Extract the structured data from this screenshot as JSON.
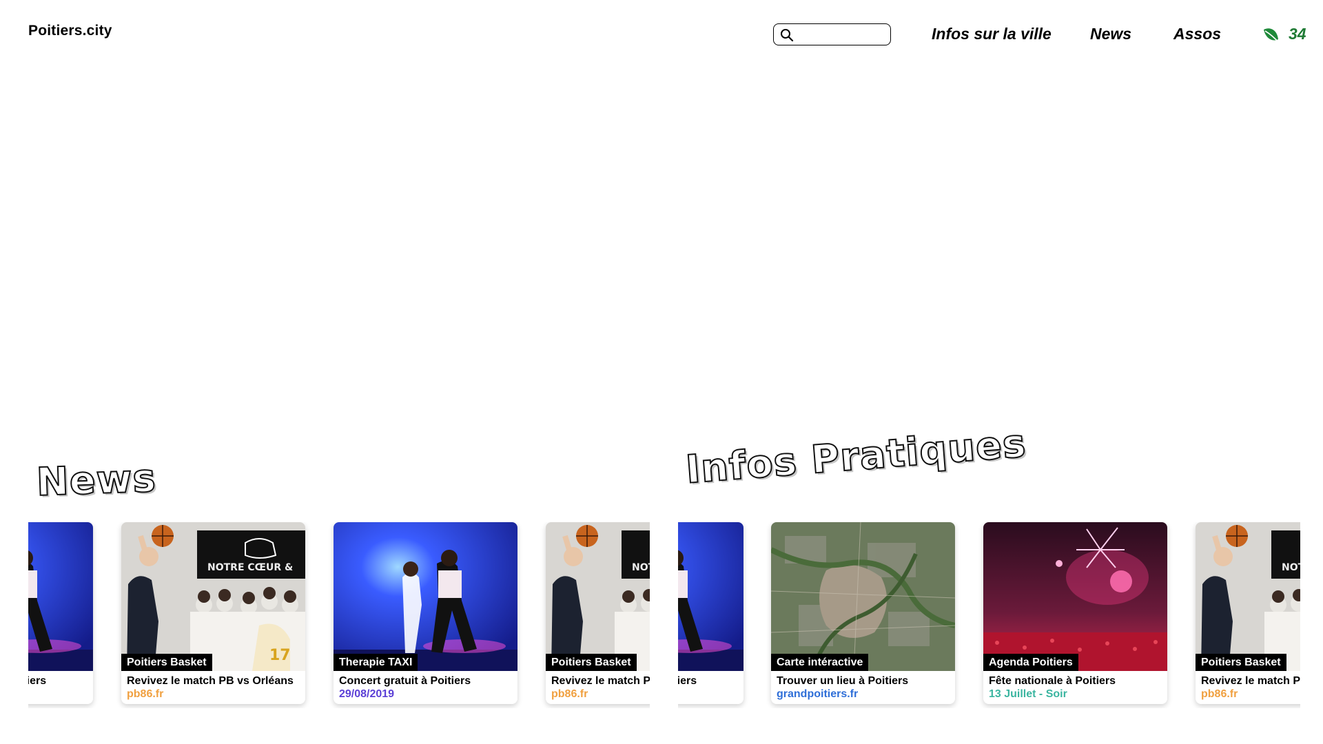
{
  "header": {
    "logo": "Poitiers.city",
    "search_placeholder": "",
    "nav": [
      "Infos sur la ville",
      "News",
      "Assos"
    ],
    "counter": "34"
  },
  "sections": {
    "news_title": "News",
    "infos_title": "Infos Pratiques"
  },
  "news_cards": [
    {
      "source": "Therapie TAXI",
      "title": "Concert gratuit à Poitiers",
      "sub": "29/08/2019",
      "sub_color": "#5b3fd6",
      "image": "concert"
    },
    {
      "source": "Poitiers Basket",
      "title": "Revivez le match PB vs Orléans",
      "sub": "pb86.fr",
      "sub_color": "#f0a040",
      "image": "basket"
    },
    {
      "source": "Therapie TAXI",
      "title": "Concert gratuit à Poitiers",
      "sub": "29/08/2019",
      "sub_color": "#5b3fd6",
      "image": "concert"
    },
    {
      "source": "Poitiers Basket",
      "title": "Revivez le match PB vs Orléans",
      "sub": "pb86.fr",
      "sub_color": "#f0a040",
      "image": "basket"
    }
  ],
  "infos_cards": [
    {
      "source": "Therapie TAXI",
      "title": "Concert gratuit à Poitiers",
      "sub": "29/08/2019",
      "sub_color": "#5b3fd6",
      "image": "concert"
    },
    {
      "source": "Carte intéractive",
      "title": "Trouver un lieu à Poitiers",
      "sub": "grandpoitiers.fr",
      "sub_color": "#2f6fd8",
      "image": "map"
    },
    {
      "source": "Agenda Poitiers",
      "title": "Fête nationale à Poitiers",
      "sub": "13 Juillet - Soir",
      "sub_color": "#3bb5a0",
      "image": "fireworks"
    },
    {
      "source": "Poitiers Basket",
      "title": "Revivez le match PB vs Orléans",
      "sub": "pb86.fr",
      "sub_color": "#f0a040",
      "image": "basket"
    }
  ],
  "colors": {
    "leaf": "#1f8a3a",
    "counter": "#1f7a34"
  },
  "icons": {
    "search": "search-icon",
    "leaf": "leaf-icon"
  }
}
